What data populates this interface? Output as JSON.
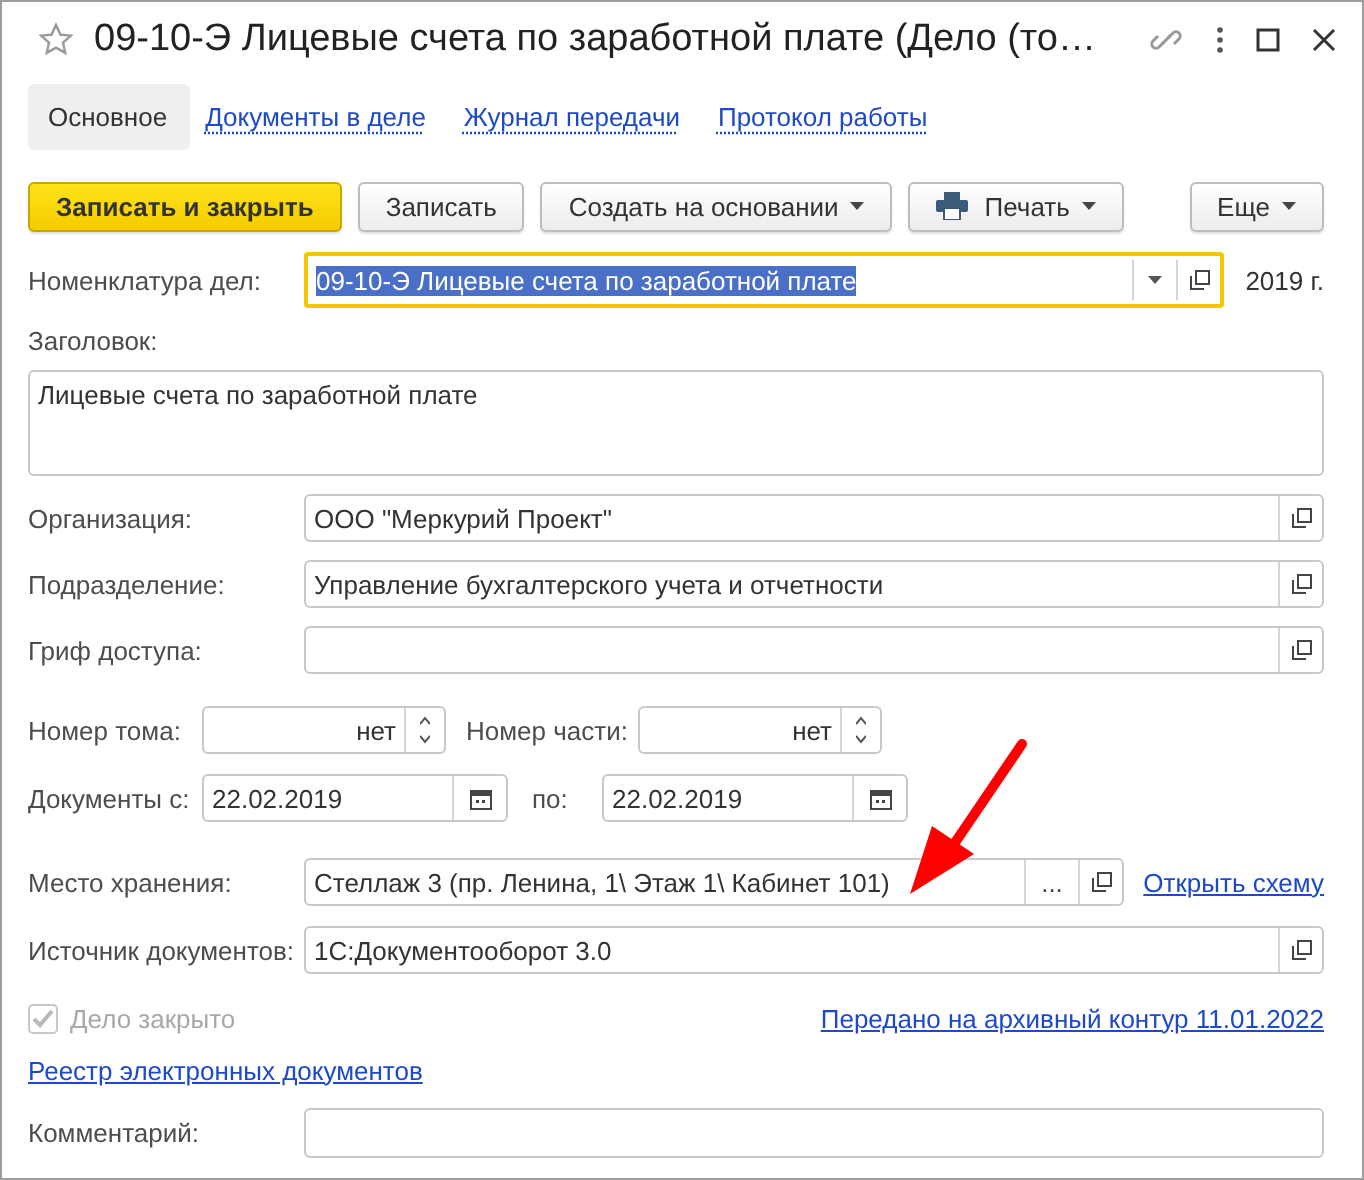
{
  "window": {
    "title": "09-10-Э Лицевые счета по заработной плате (Дело (то…",
    "favorite": false
  },
  "tabs": [
    {
      "label": "Основное",
      "selected": true
    },
    {
      "label": "Документы в деле",
      "selected": false
    },
    {
      "label": "Журнал передачи",
      "selected": false
    },
    {
      "label": "Протокол работы",
      "selected": false
    }
  ],
  "toolbar": {
    "buttons": [
      {
        "label": "Записать и закрыть",
        "kind": "primary"
      },
      {
        "label": "Записать",
        "kind": "plain"
      },
      {
        "label": "Создать на основании",
        "kind": "menu"
      },
      {
        "label": "Печать",
        "kind": "print"
      }
    ],
    "more": "Еще"
  },
  "nomenclature": {
    "label": "Номенклатура дел:",
    "value": "09-10-Э Лицевые счета по заработной плате",
    "focused": true,
    "year": "2019 г."
  },
  "heading": {
    "label": "Заголовок:",
    "value": "Лицевые счета по заработной плате"
  },
  "refs": [
    {
      "label": "Организация:",
      "value": "ООО \"Меркурий Проект\""
    },
    {
      "label": "Подразделение:",
      "value": "Управление бухгалтерского учета и отчетности"
    },
    {
      "label": "Гриф доступа:"
    }
  ],
  "volume": {
    "label": "Номер тома:",
    "value": "нет"
  },
  "part": {
    "label": "Номер части:",
    "value": "нет"
  },
  "dates": {
    "label": "Документы с:",
    "from": "22.02.2019",
    "to_label": "по:",
    "to": "22.02.2019"
  },
  "storage": {
    "label": "Место хранения:",
    "value": "Стеллаж 3 (пр. Ленина, 1\\ Этаж 1\\ Кабинет 101)",
    "choice": "...",
    "link": "Открыть схему"
  },
  "source": {
    "label": "Источник документов:",
    "value": "1С:Документооборот 3.0"
  },
  "closed": {
    "label": "Дело закрыто",
    "checked": true,
    "disabled": true
  },
  "archive_link": "Передано на архивный контур 11.01.2022",
  "registry_link": "Реестр электронных документов",
  "comment": {
    "label": "Комментарий:"
  }
}
